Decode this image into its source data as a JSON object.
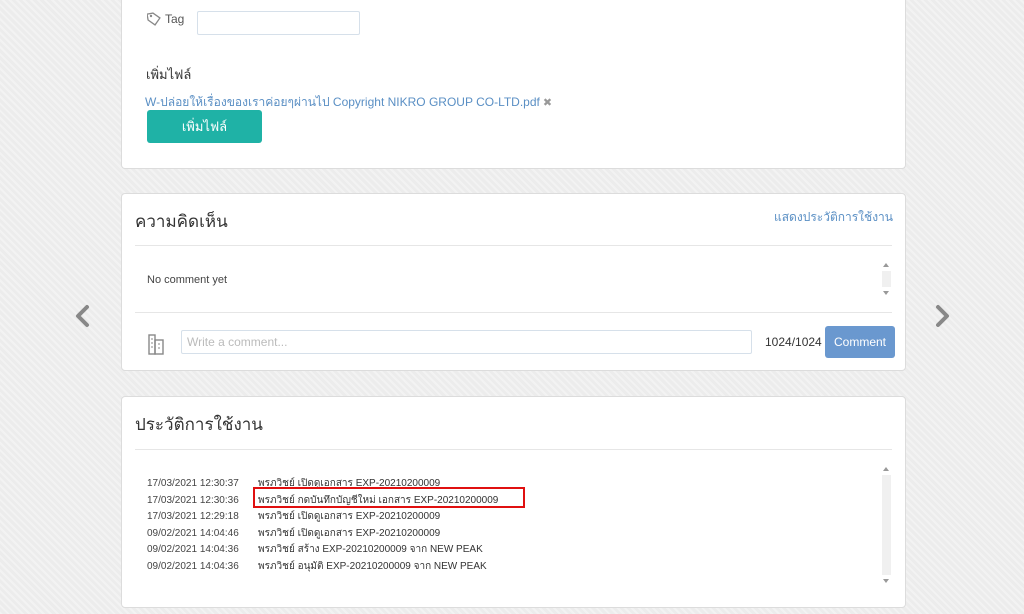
{
  "attachment_panel": {
    "tag_label": "Tag",
    "tag_value": "",
    "attach_title": "เพิ่มไฟล์",
    "file_name": "W-ปล่อยให้เรื่องของเราค่อยๆผ่านไป Copyright NIKRO GROUP CO-LTD.pdf",
    "remove_icon": "✖",
    "add_file_button": "เพิ่มไฟล์"
  },
  "comments_panel": {
    "title": "ความคิดเห็น",
    "history_link": "แสดงประวัติการใช้งาน",
    "empty_text": "No comment yet",
    "input_placeholder": "Write a comment...",
    "input_value": "",
    "char_count": "1024/1024",
    "comment_button": "Comment"
  },
  "history_panel": {
    "title": "ประวัติการใช้งาน",
    "entries": [
      {
        "time": "17/03/2021 12:30:37",
        "text": "พรภวิชย์ เปิดดูเอกสาร EXP-20210200009"
      },
      {
        "time": "17/03/2021 12:30:36",
        "text": "พรภวิชย์ กดบันทึกบัญชีใหม่ เอกสาร EXP-20210200009"
      },
      {
        "time": "17/03/2021 12:29:18",
        "text": "พรภวิชย์ เปิดดูเอกสาร EXP-20210200009"
      },
      {
        "time": "09/02/2021 14:04:46",
        "text": "พรภวิชย์ เปิดดูเอกสาร EXP-20210200009"
      },
      {
        "time": "09/02/2021 14:04:36",
        "text": "พรภวิชย์ สร้าง EXP-20210200009 จาก NEW PEAK"
      },
      {
        "time": "09/02/2021 14:04:36",
        "text": "พรภวิชย์ อนุมัติ EXP-20210200009 จาก NEW PEAK"
      }
    ]
  },
  "navigation": {
    "prev_icon": "chevron-left-icon",
    "next_icon": "chevron-right-icon"
  },
  "colors": {
    "accent_teal": "#1fb2a6",
    "comment_blue": "#6a98cf",
    "link_blue": "#5a8fc4",
    "highlight_red": "#e01010"
  }
}
